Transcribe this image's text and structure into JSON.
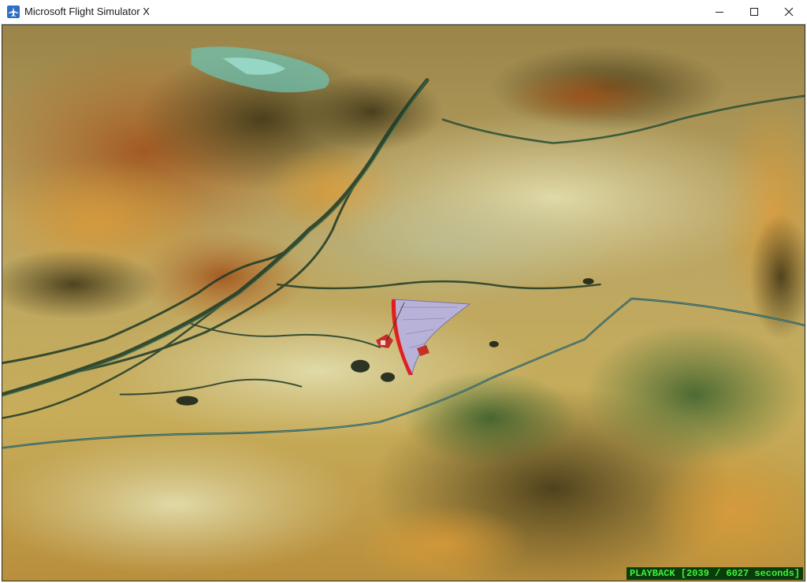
{
  "window": {
    "title": "Microsoft Flight Simulator X",
    "icon": "airplane-icon",
    "controls": {
      "minimize": "minimize-icon",
      "maximize": "maximize-icon",
      "close": "close-icon"
    }
  },
  "scene": {
    "aircraft": "hang-glider",
    "terrain": "desert-valley-aerial"
  },
  "status": {
    "text": "PLAYBACK [2039 / 6027 seconds]",
    "color": "#3df33d"
  }
}
